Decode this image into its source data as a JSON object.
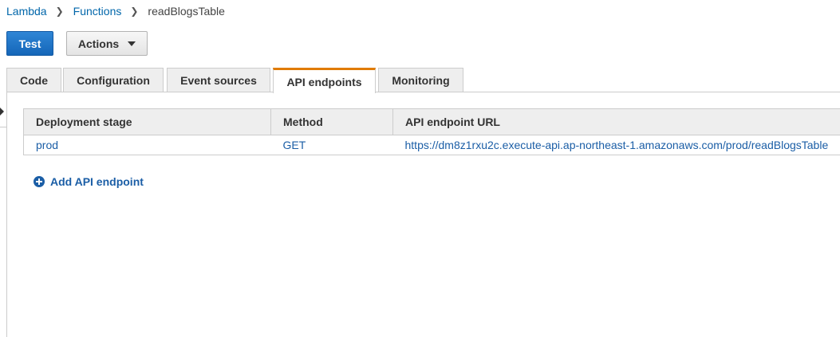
{
  "breadcrumb": {
    "items": [
      "Lambda",
      "Functions"
    ],
    "current": "readBlogsTable"
  },
  "toolbar": {
    "test_label": "Test",
    "actions_label": "Actions"
  },
  "tabs": [
    {
      "label": "Code",
      "active": false
    },
    {
      "label": "Configuration",
      "active": false
    },
    {
      "label": "Event sources",
      "active": false
    },
    {
      "label": "API endpoints",
      "active": true
    },
    {
      "label": "Monitoring",
      "active": false
    }
  ],
  "table": {
    "columns": [
      "Deployment stage",
      "Method",
      "API endpoint URL"
    ],
    "rows": [
      {
        "stage": "prod",
        "method": "GET",
        "url": "https://dm8z1rxu2c.execute-api.ap-northeast-1.amazonaws.com/prod/readBlogsTable"
      }
    ]
  },
  "add_endpoint_label": "Add API endpoint",
  "colors": {
    "accent": "#e07b00",
    "link": "#1b5ea6",
    "primary_button": "#1566b8"
  },
  "icons": {
    "breadcrumb_separator": "chevron-right-icon",
    "actions_dropdown": "caret-down-icon",
    "add": "plus-circle-icon",
    "side_toggle": "caret-right-icon"
  }
}
